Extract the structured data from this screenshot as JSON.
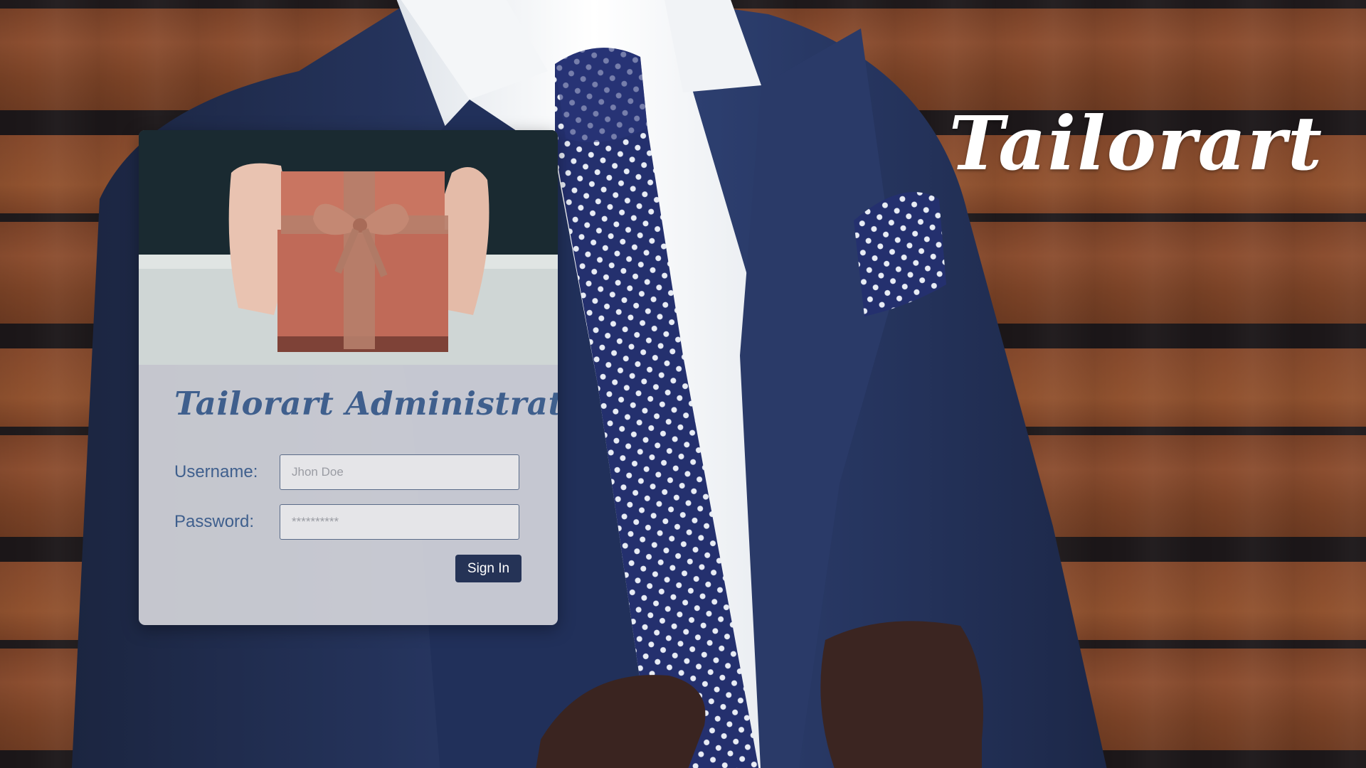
{
  "brand": {
    "name": "Tailorart"
  },
  "login": {
    "title": "Tailorart Administrator",
    "username_label": "Username:",
    "username_placeholder": "Jhon Doe",
    "password_label": "Password:",
    "password_placeholder": "**********",
    "submit_label": "Sign In"
  },
  "colors": {
    "accent_text": "#3f5f8d",
    "button_bg": "#253356",
    "button_text": "#ffffff",
    "brand_text": "#ffffff"
  }
}
